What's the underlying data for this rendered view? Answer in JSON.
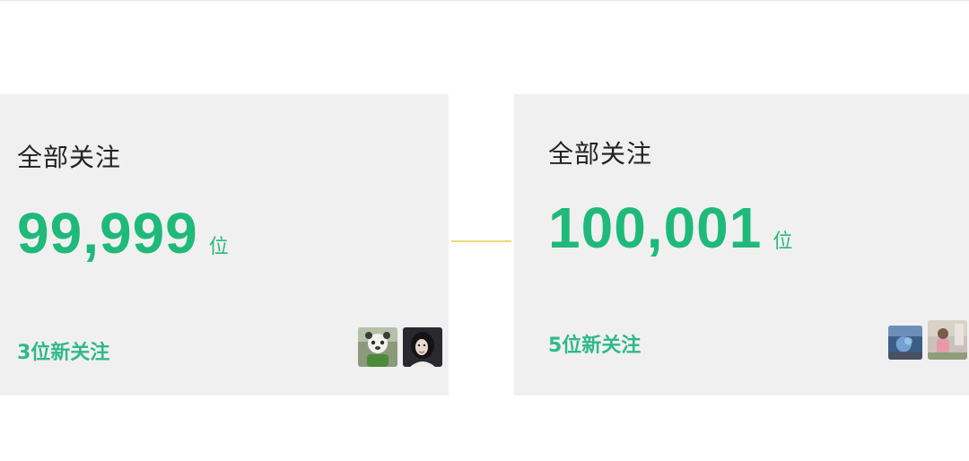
{
  "left_card": {
    "title": "全部关注",
    "count": "99,999",
    "unit": "位",
    "new_follow_text": "3位新关注",
    "avatars": [
      "avatar-icon",
      "avatar-icon"
    ]
  },
  "right_card": {
    "title": "全部关注",
    "count": "100,001",
    "unit": "位",
    "new_follow_text": "5位新关注",
    "avatars": [
      "avatar-icon",
      "avatar-icon"
    ]
  },
  "colors": {
    "accent_green": "#1fb97a",
    "card_background": "#f1f0f1",
    "connector_yellow": "#f0d878",
    "title_text": "#222222"
  }
}
